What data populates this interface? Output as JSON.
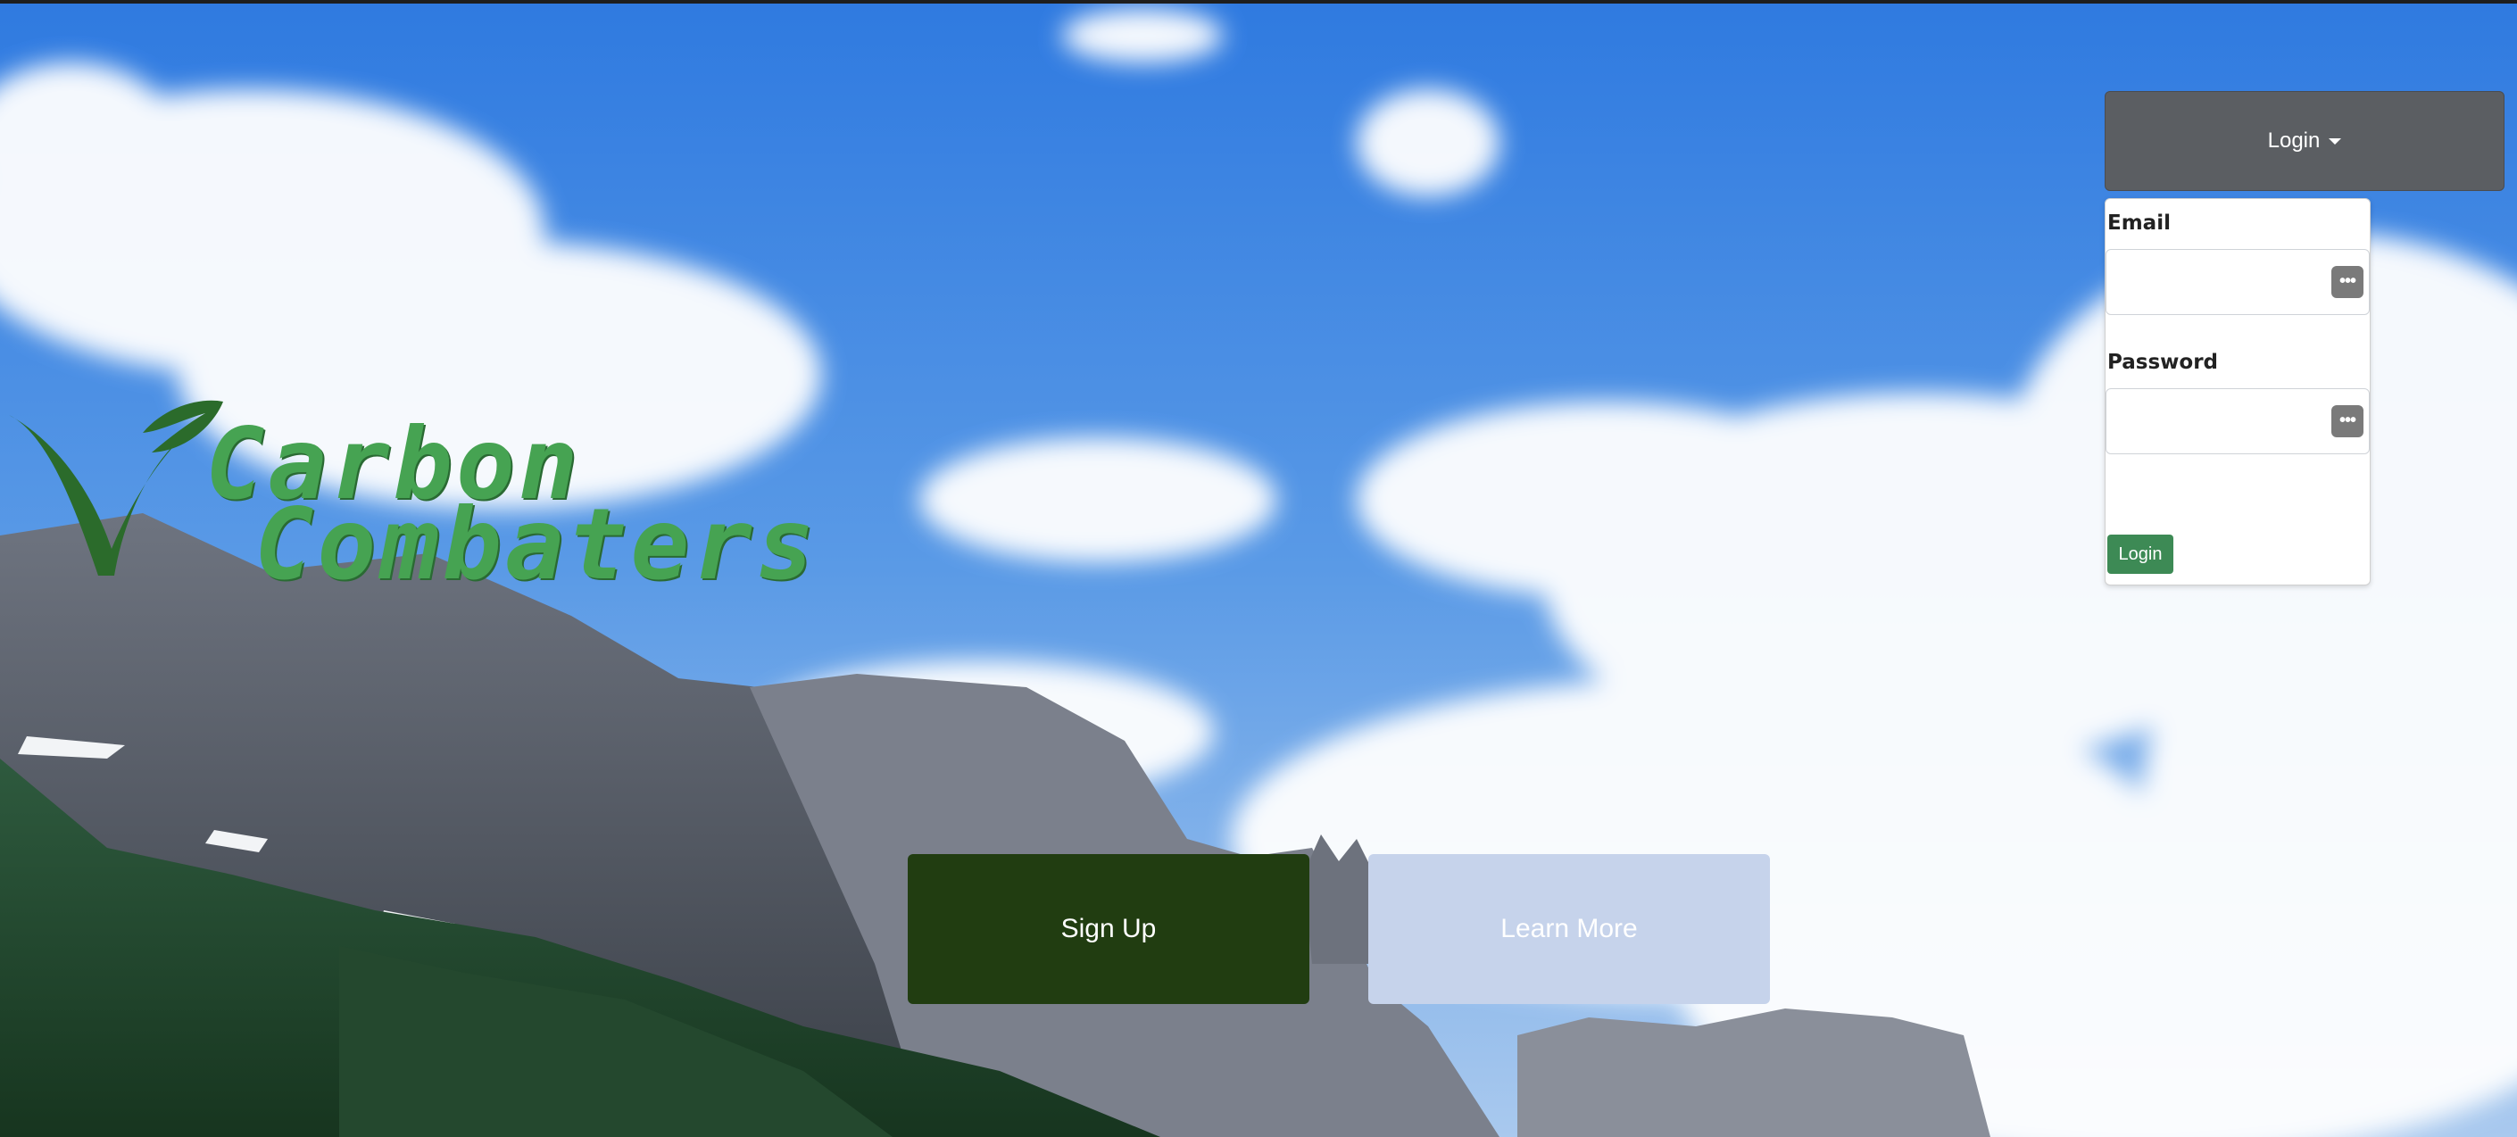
{
  "brand": {
    "name_line1": "Carbon",
    "name_line2": "Combaters",
    "logo_icon": "leaf-checkmark-icon",
    "logo_color": "#46a352"
  },
  "login": {
    "toggle_label": "Login",
    "toggle_icon": "caret-down-icon",
    "email_label": "Email",
    "email_value": "",
    "password_label": "Password",
    "password_value": "",
    "field_icon": "password-manager-icon",
    "submit_label": "Login",
    "toggle_color": "#5b5e62",
    "submit_color": "#3d8a55"
  },
  "cta": {
    "signup_label": "Sign Up",
    "learn_more_label": "Learn More",
    "signup_color": "#213d11",
    "learn_more_color": "#c6d3eb"
  },
  "background": {
    "scene_icon": "mountain-sky-landscape"
  }
}
